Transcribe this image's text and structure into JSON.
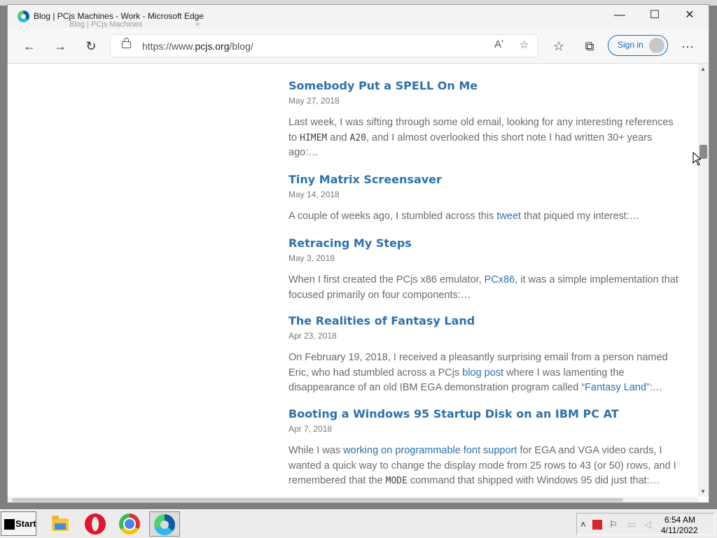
{
  "window": {
    "title": "Blog | PCjs Machines - Work - Microsoft Edge",
    "tab_label": "Blog | PCjs Machines",
    "tab_close": "×",
    "minimize": "—",
    "maximize": "☐",
    "close": "✕"
  },
  "toolbar": {
    "back": "←",
    "forward": "→",
    "refresh": "↻",
    "url_prefix": "https://www.",
    "url_host": "pcjs.org",
    "url_path": "/blog/",
    "read_aloud": "Aʼ",
    "add_favorite": "☆",
    "favorites": "☆",
    "collections": "⧉",
    "sign_in": "Sign in",
    "more": "···"
  },
  "posts": [
    {
      "title": "Somebody Put a SPELL On Me",
      "date": "May 27, 2018",
      "t1": "Last week, I was sifting through some old email, looking for any interesting references to ",
      "c1": "HIMEM",
      "t2": " and ",
      "c2": "A20",
      "t3": ", and I almost overlooked this short note I had written 30+ years ago:…"
    },
    {
      "title": "Tiny Matrix Screensaver",
      "date": "May 14, 2018",
      "t1": "A couple of weeks ago, I stumbled across this ",
      "l1": "tweet",
      "t2": " that piqued my interest:…"
    },
    {
      "title": "Retracing My Steps",
      "date": "May 3, 2018",
      "t1": "When I first created the PCjs x86 emulator, ",
      "l1": "PCx86",
      "t2": ", it was a simple implementation that focused primarily on four components:…"
    },
    {
      "title": "The Realities of Fantasy Land",
      "date": "Apr 23, 2018",
      "t1": "On February 19, 2018, I received a pleasantly surprising email from a person named Eric, who had stumbled across a PCjs ",
      "l1": "blog post",
      "t2": " where I was lamenting the disappearance of an old IBM EGA demonstration program called “",
      "l2": "Fantasy Land",
      "t3": "”:…"
    },
    {
      "title": "Booting a Windows 95 Startup Disk on an IBM PC AT",
      "date": "Apr 7, 2018",
      "t1": "While I was ",
      "l1": "working on programmable font support",
      "t2": " for EGA and VGA video cards, I wanted a quick way to change the display mode from 25 rows to 43 (or 50) rows, and I remembered that the ",
      "c1": "MODE",
      "t3": " command that shipped with Windows 95 did just that:…"
    }
  ],
  "taskbar": {
    "start": "Start",
    "tray_expand": "˄",
    "time": "6:54 AM",
    "date": "4/11/2022"
  },
  "colors": {
    "link": "#2d71ac",
    "body_text": "#6b6b6b",
    "accent": "#0f6cbd"
  }
}
